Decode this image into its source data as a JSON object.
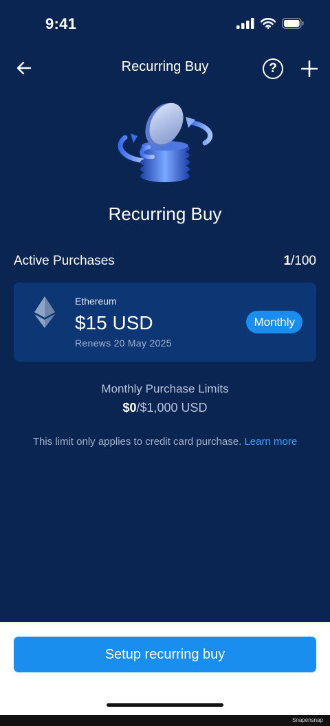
{
  "status_bar": {
    "time": "9:41"
  },
  "nav": {
    "title": "Recurring Buy",
    "help_label": "?"
  },
  "hero": {
    "title": "Recurring Buy"
  },
  "active_purchases": {
    "title": "Active Purchases",
    "count_current": "1",
    "count_total": "/100",
    "items": [
      {
        "asset": "Ethereum",
        "icon": "ethereum-icon",
        "amount": "$15 USD",
        "renews": "Renews 20 May 2025",
        "frequency": "Monthly"
      }
    ]
  },
  "limits": {
    "label": "Monthly Purchase Limits",
    "used": "$0",
    "max": "/$1,000 USD",
    "note": "This limit only applies to credit card purchase.",
    "learn_more": "Learn more"
  },
  "cta": {
    "label": "Setup recurring buy"
  },
  "watermark": "Snapensnap",
  "colors": {
    "background": "#0a2551",
    "card": "#0d3675",
    "accent": "#1a8eef",
    "link": "#3aa3ff"
  }
}
